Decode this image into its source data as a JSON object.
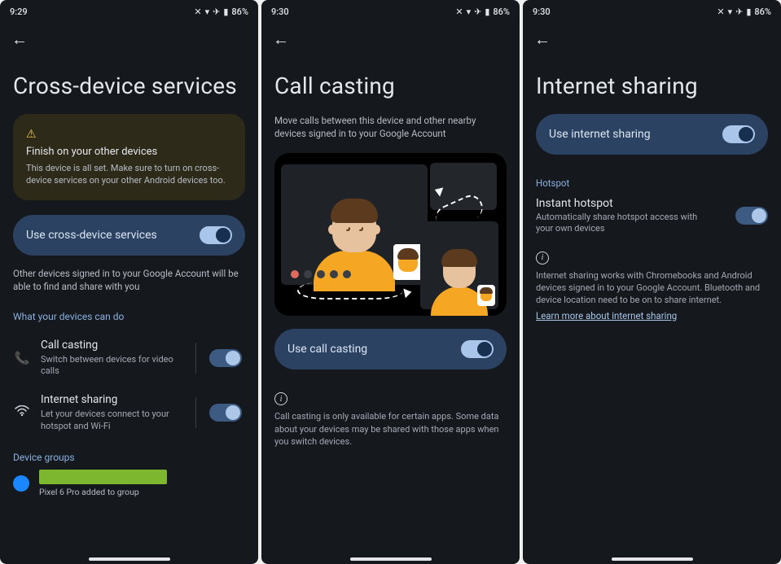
{
  "screens": {
    "s1": {
      "time": "9:29",
      "battery": "86%",
      "title": "Cross-device services",
      "warning_title": "Finish on your other devices",
      "warning_text": "This device is all set. Make sure to turn on cross-device services on your other Android devices too.",
      "toggle_label": "Use cross-device services",
      "helper": "Other devices signed in to your Google Account will be able to find and share with you",
      "section": "What your devices can do",
      "features": {
        "call": {
          "title": "Call casting",
          "sub": "Switch between devices for video calls"
        },
        "internet": {
          "title": "Internet sharing",
          "sub": "Let your devices connect to your hotspot and Wi-Fi"
        }
      },
      "groups_header": "Device groups",
      "group_caption": "Pixel 6 Pro added to group"
    },
    "s2": {
      "time": "9:30",
      "battery": "86%",
      "title": "Call casting",
      "subtitle": "Move calls between this device and other nearby devices signed in to your Google Account",
      "toggle_label": "Use call casting",
      "info": "Call casting is only available for certain apps. Some data about your devices may be shared with those apps when you switch devices."
    },
    "s3": {
      "time": "9:30",
      "battery": "86%",
      "title": "Internet sharing",
      "toggle_label": "Use internet sharing",
      "section": "Hotspot",
      "hotspot_title": "Instant hotspot",
      "hotspot_sub": "Automatically share hotspot access with your own devices",
      "info": "Internet sharing works with Chromebooks and Android devices signed in to your Google Account. Bluetooth and device location need to be on to share internet.",
      "link": "Learn more about internet sharing"
    }
  }
}
